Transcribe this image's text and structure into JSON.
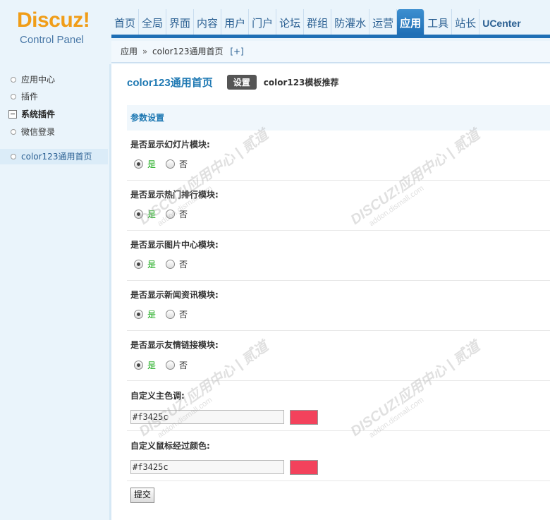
{
  "logo": {
    "brand": "Discuz!",
    "subtitle": "Control Panel"
  },
  "nav": {
    "items": [
      "首页",
      "全局",
      "界面",
      "内容",
      "用户",
      "门户",
      "论坛",
      "群组",
      "防灌水",
      "运营",
      "应用",
      "工具",
      "站长",
      "UCenter"
    ],
    "active_index": 10
  },
  "breadcrumb": {
    "root": "应用",
    "separator": "»",
    "current": "color123通用首页",
    "plus": "[+]"
  },
  "sidebar": {
    "items": [
      "应用中心",
      "插件",
      "系统插件",
      "微信登录",
      "color123通用首页"
    ]
  },
  "main": {
    "title": "color123通用首页",
    "tab_setting": "设置",
    "tab_template": "color123模板推荐",
    "section_title": "参数设置",
    "yes": "是",
    "no": "否",
    "fields": [
      {
        "label": "是否显示幻灯片模块:",
        "value": "是"
      },
      {
        "label": "是否显示热门排行模块:",
        "value": "是"
      },
      {
        "label": "是否显示图片中心模块:",
        "value": "是"
      },
      {
        "label": "是否显示新闻资讯模块:",
        "value": "是"
      },
      {
        "label": "是否显示友情链接模块:",
        "value": "是"
      }
    ],
    "color_fields": [
      {
        "label": "自定义主色调:",
        "value": "#f3425c",
        "swatch": "#f3425c"
      },
      {
        "label": "自定义鼠标经过颜色:",
        "value": "#f3425c",
        "swatch": "#f3425c"
      }
    ],
    "submit": "提交"
  },
  "watermark": {
    "brand": "DISCUZ!应用中心 | 贰道",
    "url": "addon.dismall.com"
  },
  "colors": {
    "accent": "#1f6fb5",
    "logo": "#f09d18",
    "title": "#1f79b3",
    "yes_text": "#13a713"
  }
}
